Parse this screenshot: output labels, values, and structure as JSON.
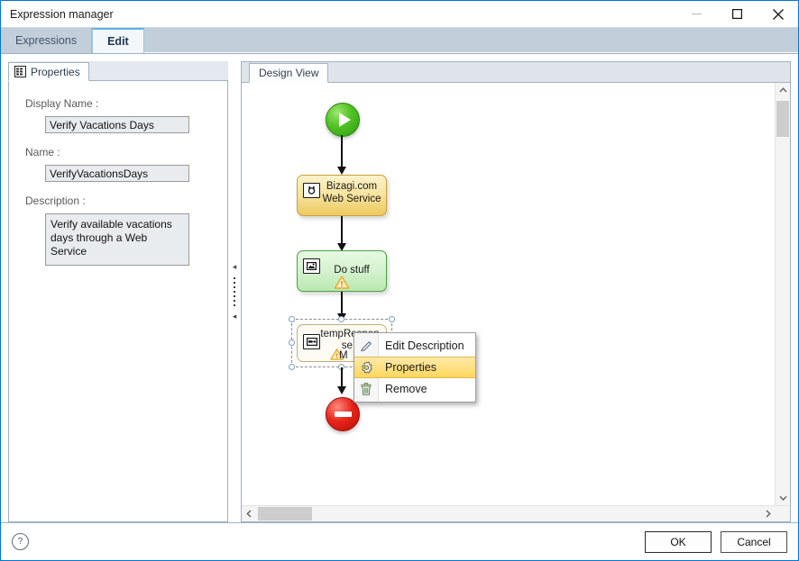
{
  "window": {
    "title": "Expression manager",
    "caption_buttons": [
      {
        "name": "minimize",
        "glyph": "minimize-icon"
      },
      {
        "name": "maximize",
        "glyph": "maximize-icon"
      },
      {
        "name": "close",
        "glyph": "close-icon"
      }
    ]
  },
  "tabs": [
    {
      "label": "Expressions",
      "active": false
    },
    {
      "label": "Edit",
      "active": true
    }
  ],
  "properties_panel": {
    "tab_label": "Properties",
    "tab_icon": "properties-grid-icon",
    "fields": [
      {
        "label": "Display Name :",
        "value": "Verify Vacations Days",
        "type": "text"
      },
      {
        "label": "Name :",
        "value": "VerifyVacationsDays",
        "type": "text"
      },
      {
        "label": "Description :",
        "value": "Verify available vacations days through a Web Service",
        "type": "textarea"
      }
    ]
  },
  "design_view": {
    "tab_label": "Design View",
    "nodes": [
      {
        "id": "start",
        "type": "start-event",
        "label": ""
      },
      {
        "id": "webservice",
        "type": "service-task",
        "label": "Bizagi.com\nWeb Service",
        "line1": "Bizagi.com",
        "line2": "Web Service",
        "icon": "web-service-icon",
        "warning": false
      },
      {
        "id": "dostuff",
        "type": "script-task",
        "line1": "Do stuff",
        "line2": "",
        "icon": "script-task-icon",
        "warning": true
      },
      {
        "id": "tempresponse",
        "type": "task",
        "line1": "tempRespon",
        "line2": "se t",
        "line3": "M",
        "icon": "assignment-icon",
        "warning": true,
        "selected": true
      },
      {
        "id": "end",
        "type": "end-event",
        "label": ""
      }
    ],
    "scroll": {
      "vertical_thumb_position": "top",
      "horizontal_thumb_position": "left"
    }
  },
  "context_menu": {
    "items": [
      {
        "label": "Edit Description",
        "icon": "pencil-icon",
        "highlighted": false
      },
      {
        "label": "Properties",
        "icon": "gear-icon",
        "highlighted": true
      },
      {
        "label": "Remove",
        "icon": "trash-icon",
        "highlighted": false
      }
    ]
  },
  "footer": {
    "help_glyph": "?",
    "ok_label": "OK",
    "cancel_label": "Cancel"
  },
  "colors": {
    "window_border": "#0078d7",
    "tabstrip_bg": "#cfd9e4",
    "active_tab_bg": "#f2f7fb",
    "service_task": "#f7e49f",
    "script_task": "#d4f2ce",
    "start_event": "#53c326",
    "end_event": "#e8261c",
    "menu_highlight": "#ffd75e",
    "warning": "#f5a623"
  }
}
